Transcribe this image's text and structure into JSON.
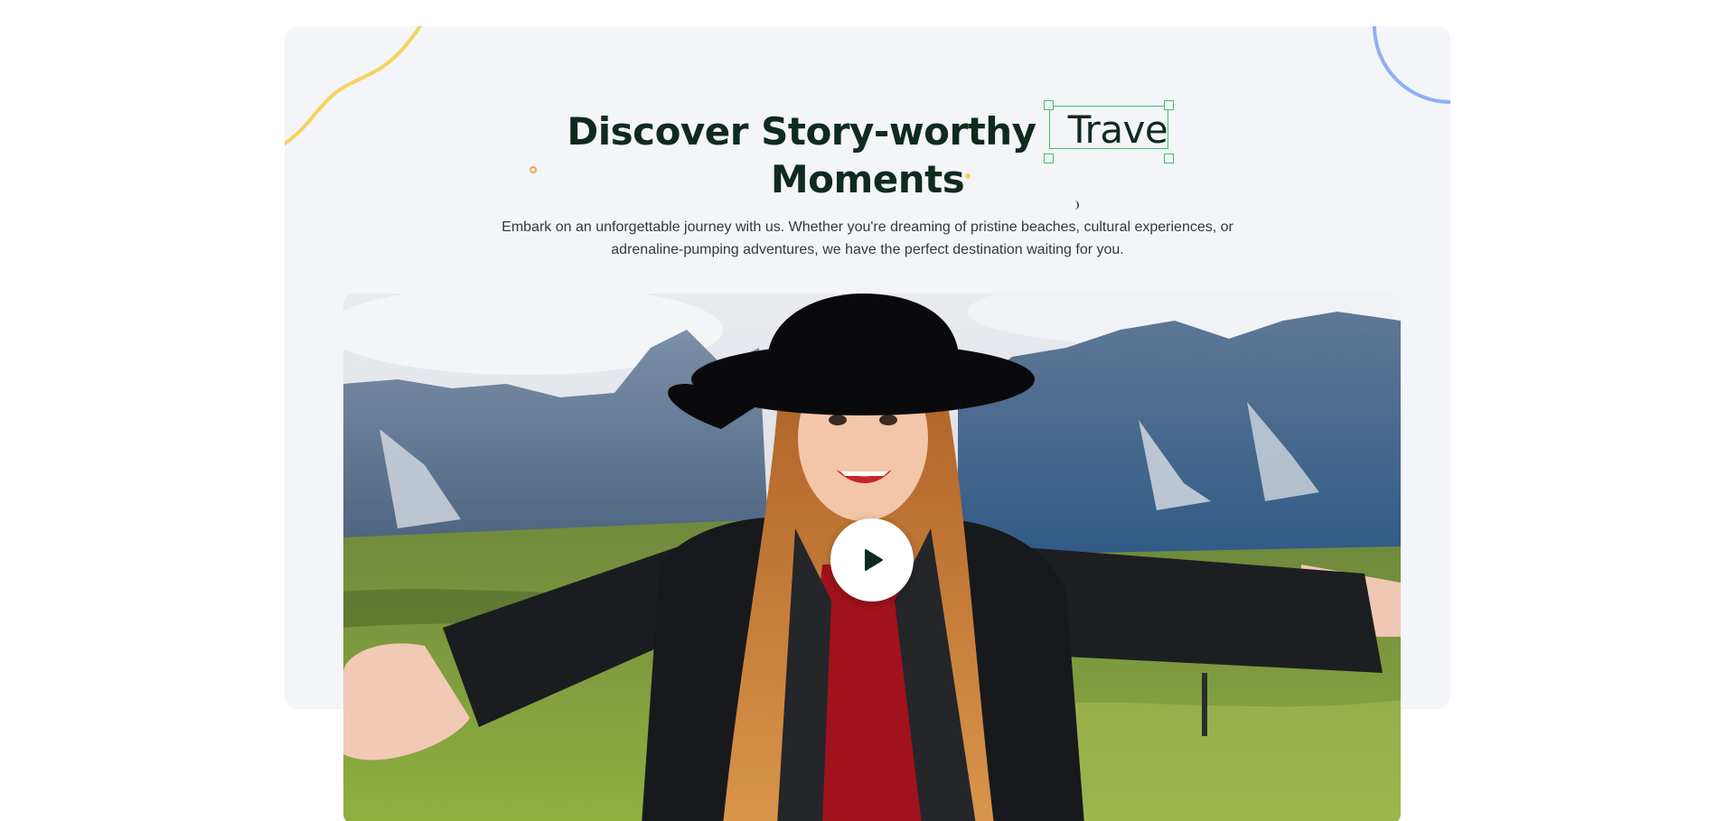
{
  "hero": {
    "title_line1": "Discover Story-worthy",
    "typed_word": "Trave",
    "title_line2": "Moments",
    "subtitle": "Embark on an unforgettable journey with us. Whether you're dreaming of pristine beaches, cultural experiences, or adrenaline-pumping adventures, we have the perfect destination waiting for you."
  },
  "video": {
    "image_description_icon": "traveler-selfie-mountains",
    "play_icon": "play-icon"
  },
  "colors": {
    "heading": "#0f2a1f",
    "accent_green": "#3cc06e",
    "card_background": "#f4f5f8",
    "squiggle_yellow": "#f5d35d",
    "ring_blue": "#8fb0f5",
    "dot_orange": "#f0a24f"
  }
}
